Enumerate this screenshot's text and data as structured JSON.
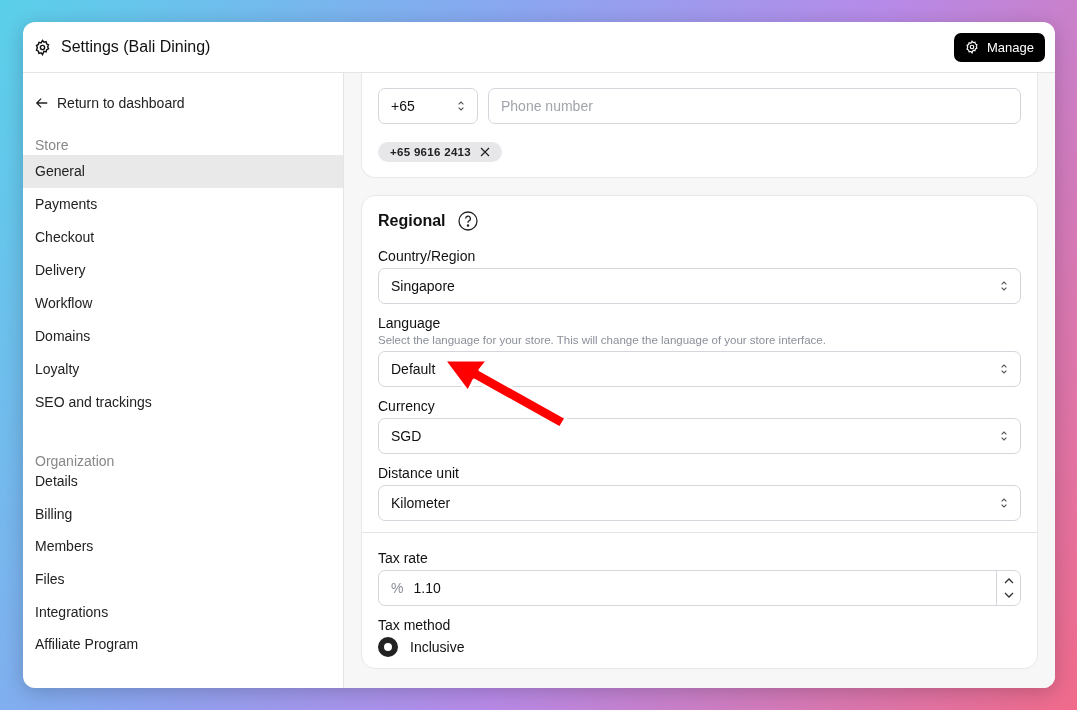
{
  "window": {
    "title": "Settings (Bali Dining)",
    "manage_button": "Manage"
  },
  "sidebar": {
    "back_link": "Return to dashboard",
    "sections": [
      {
        "heading": "Store",
        "items": [
          {
            "label": "General",
            "selected": true
          },
          {
            "label": "Payments",
            "selected": false
          },
          {
            "label": "Checkout",
            "selected": false
          },
          {
            "label": "Delivery",
            "selected": false
          },
          {
            "label": "Workflow",
            "selected": false
          },
          {
            "label": "Domains",
            "selected": false
          },
          {
            "label": "Loyalty",
            "selected": false
          },
          {
            "label": "SEO and trackings",
            "selected": false
          }
        ]
      },
      {
        "heading": "Organization",
        "items": [
          {
            "label": "Details",
            "selected": false
          },
          {
            "label": "Billing",
            "selected": false
          },
          {
            "label": "Members",
            "selected": false
          },
          {
            "label": "Files",
            "selected": false
          },
          {
            "label": "Integrations",
            "selected": false
          },
          {
            "label": "Affiliate Program",
            "selected": false
          }
        ]
      }
    ]
  },
  "phone_card": {
    "country_code": "+65",
    "phone_placeholder": "Phone number",
    "chips": [
      "+65 9616 2413"
    ]
  },
  "regional": {
    "title": "Regional",
    "fields": [
      {
        "kind": "select",
        "label": "Country/Region",
        "value": "Singapore"
      },
      {
        "kind": "select",
        "label": "Language",
        "hint": "Select the language for your store. This will change the language of your store interface.",
        "value": "Default"
      },
      {
        "kind": "select",
        "label": "Currency",
        "value": "SGD"
      },
      {
        "kind": "select",
        "label": "Distance unit",
        "value": "Kilometer"
      }
    ],
    "tax_rate": {
      "label": "Tax rate",
      "prefix": "%",
      "value": "1.10"
    },
    "tax_method": {
      "label": "Tax method",
      "options": [
        {
          "label": "Inclusive",
          "selected": true
        }
      ]
    }
  }
}
